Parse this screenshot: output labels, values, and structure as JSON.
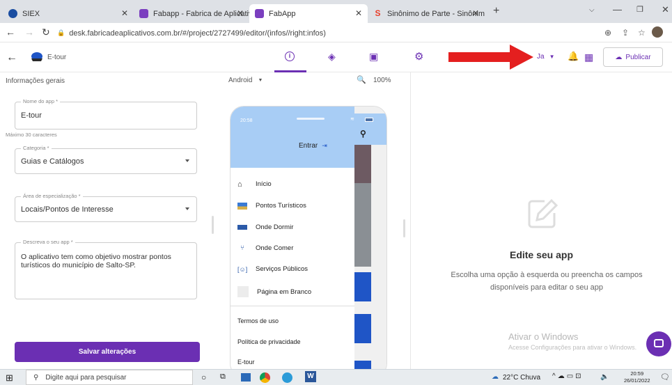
{
  "tabs": [
    {
      "label": "SIEX",
      "favicon_color": "#1a4da1"
    },
    {
      "label": "Fabapp - Fabrica de Aplicativos",
      "favicon_color": "#7b3fbf"
    },
    {
      "label": "FabApp",
      "favicon_color": "#7b3fbf"
    },
    {
      "label": "Sinônimo de Parte - Sinônimos",
      "favicon_color": "#e8402c"
    }
  ],
  "address": {
    "url": "desk.fabricadeaplicativos.com.br/#/project/2727499/editor/(infos//right:infos)"
  },
  "header": {
    "app_name": "E-tour",
    "lang_label": "Ja",
    "publish_label": "Publicar"
  },
  "left": {
    "section_title": "Informações gerais",
    "name_label": "Nome do app *",
    "name_value": "E-tour",
    "name_hint": "Máximo 30 caracteres",
    "category_label": "Categoria *",
    "category_value": "Guias e Catálogos",
    "area_label": "Área de especialização *",
    "area_value": "Locais/Pontos de Interesse",
    "desc_label": "Descreva o seu app *",
    "desc_value": "O aplicativo tem como objetivo mostrar pontos turísticos do município de Salto-SP.",
    "save_label": "Salvar alterações"
  },
  "preview": {
    "platform": "Android",
    "zoom": "100%"
  },
  "phone": {
    "time": "20:58",
    "enter_label": "Entrar",
    "menu": [
      {
        "label": "Início",
        "icon": "home-icon"
      },
      {
        "label": "Pontos Turísticos",
        "icon": "landscape-icon"
      },
      {
        "label": "Onde Dormir",
        "icon": "bed-icon"
      },
      {
        "label": "Onde Comer",
        "icon": "cutlery-icon"
      },
      {
        "label": "Serviços Públicos",
        "icon": "services-icon"
      },
      {
        "label": "Página em Branco",
        "icon": "blank-page-icon"
      }
    ],
    "links": [
      "Termos de uso",
      "Política de privacidade",
      "E-tour"
    ]
  },
  "right": {
    "title": "Edite seu app",
    "subtitle": "Escolha uma opção à esquerda ou preencha os campos disponíveis para editar o seu app",
    "watermark_title": "Ativar o Windows",
    "watermark_sub": "Acesse Configurações para ativar o Windows."
  },
  "taskbar": {
    "search_placeholder": "Digite aqui para pesquisar",
    "weather": "22°C Chuva",
    "time": "20:59",
    "date": "26/01/2022"
  },
  "colors": {
    "accent": "#6b2fb3",
    "arrow": "#e41f1f",
    "phone_header": "#a8cdf5",
    "menu_blue": "#1f55c6"
  }
}
